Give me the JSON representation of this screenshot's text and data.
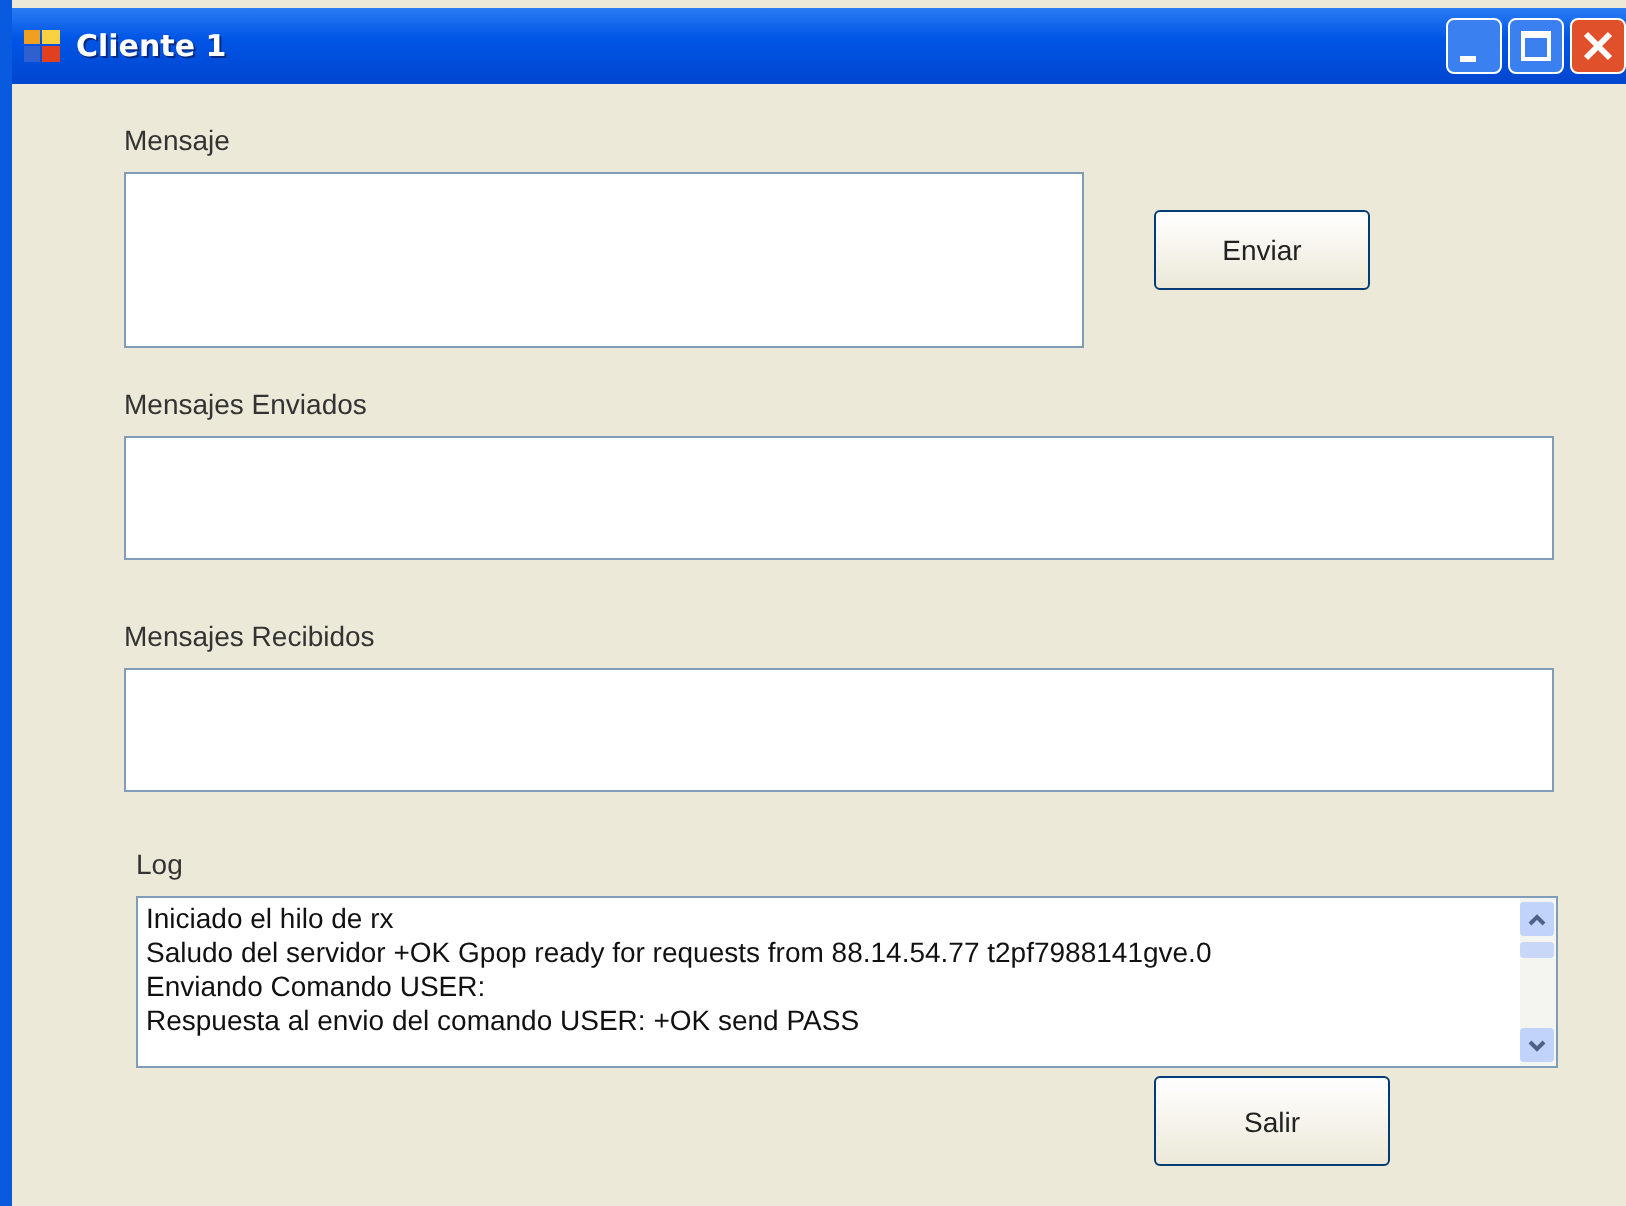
{
  "window": {
    "title": "Cliente 1"
  },
  "message": {
    "label": "Mensaje",
    "button": "Enviar"
  },
  "sent": {
    "label": "Mensajes Enviados"
  },
  "received": {
    "label": "Mensajes Recibidos"
  },
  "log": {
    "label": "Log",
    "lines": [
      "Iniciado el hilo de rx",
      "Saludo del servidor +OK Gpop ready for requests from 88.14.54.77 t2pf7988141gve.0",
      "Enviando Comando USER:",
      "Respuesta al envio del comando USER: +OK send PASS"
    ]
  },
  "exit_button": "Salir"
}
